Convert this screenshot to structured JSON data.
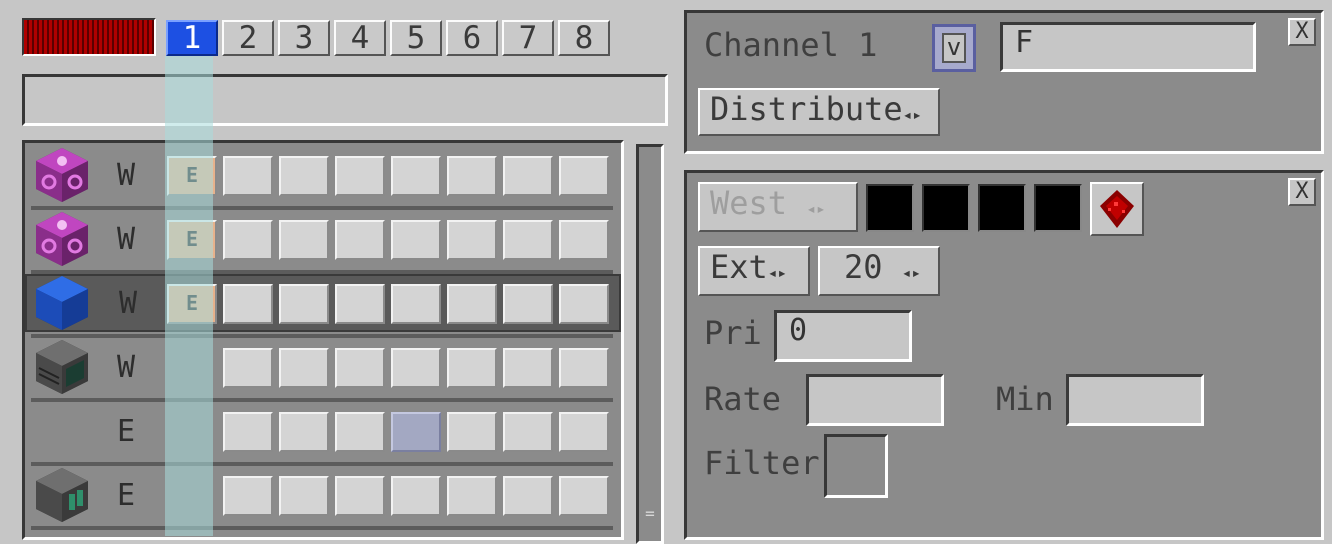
{
  "channel_tabs": [
    {
      "label": "1",
      "active": true
    },
    {
      "label": "2",
      "active": false
    },
    {
      "label": "3",
      "active": false
    },
    {
      "label": "4",
      "active": false
    },
    {
      "label": "5",
      "active": false
    },
    {
      "label": "6",
      "active": false
    },
    {
      "label": "7",
      "active": false
    },
    {
      "label": "8",
      "active": false
    }
  ],
  "energy_bar": {
    "color": "#b00000",
    "level": 1.0
  },
  "network_name": {
    "value": ""
  },
  "connectors": [
    {
      "block_icon": "machine-frame-pink-icon",
      "side": "W",
      "slots": [
        "E",
        "",
        "",
        "",
        "",
        "",
        "",
        ""
      ]
    },
    {
      "block_icon": "machine-frame-pink-icon",
      "side": "W",
      "slots": [
        "E",
        "",
        "",
        "",
        "",
        "",
        "",
        ""
      ]
    },
    {
      "block_icon": "blue-block-icon",
      "side": "W",
      "slots": [
        "E",
        "",
        "",
        "",
        "",
        "",
        "",
        ""
      ],
      "selected": true
    },
    {
      "block_icon": "computer-block-icon",
      "side": "W",
      "slots": [
        "",
        "",
        "",
        "",
        "",
        "",
        "",
        ""
      ]
    },
    {
      "block_icon": "",
      "side": "E",
      "slots": [
        "",
        "",
        "",
        "",
        "",
        "",
        "",
        ""
      ],
      "highlight_slot": 4
    },
    {
      "block_icon": "crafter-block-icon",
      "side": "E",
      "slots": [
        "",
        "",
        "",
        "",
        "",
        "",
        "",
        ""
      ]
    }
  ],
  "channel_panel": {
    "title": "Channel 1",
    "check_label": "v",
    "name_value": "F",
    "distribute_label": "Distribute",
    "close_label": "X"
  },
  "connector_panel": {
    "side_label": "West",
    "mode_label": "Ext",
    "speed_label": "20",
    "priority_label": "Pri",
    "priority_value": "0",
    "rate_label": "Rate",
    "rate_value": "",
    "min_label": "Min",
    "min_value": "",
    "filter_label": "Filter",
    "close_label": "X",
    "color_slots": [
      "#000000",
      "#000000",
      "#000000",
      "#000000"
    ],
    "redstone_icon": "redstone-dust-icon"
  },
  "colors": {
    "active_tab": "#1d50e3",
    "extract_slot": "#e7b28c",
    "highlight_column": "#aadcdc"
  }
}
